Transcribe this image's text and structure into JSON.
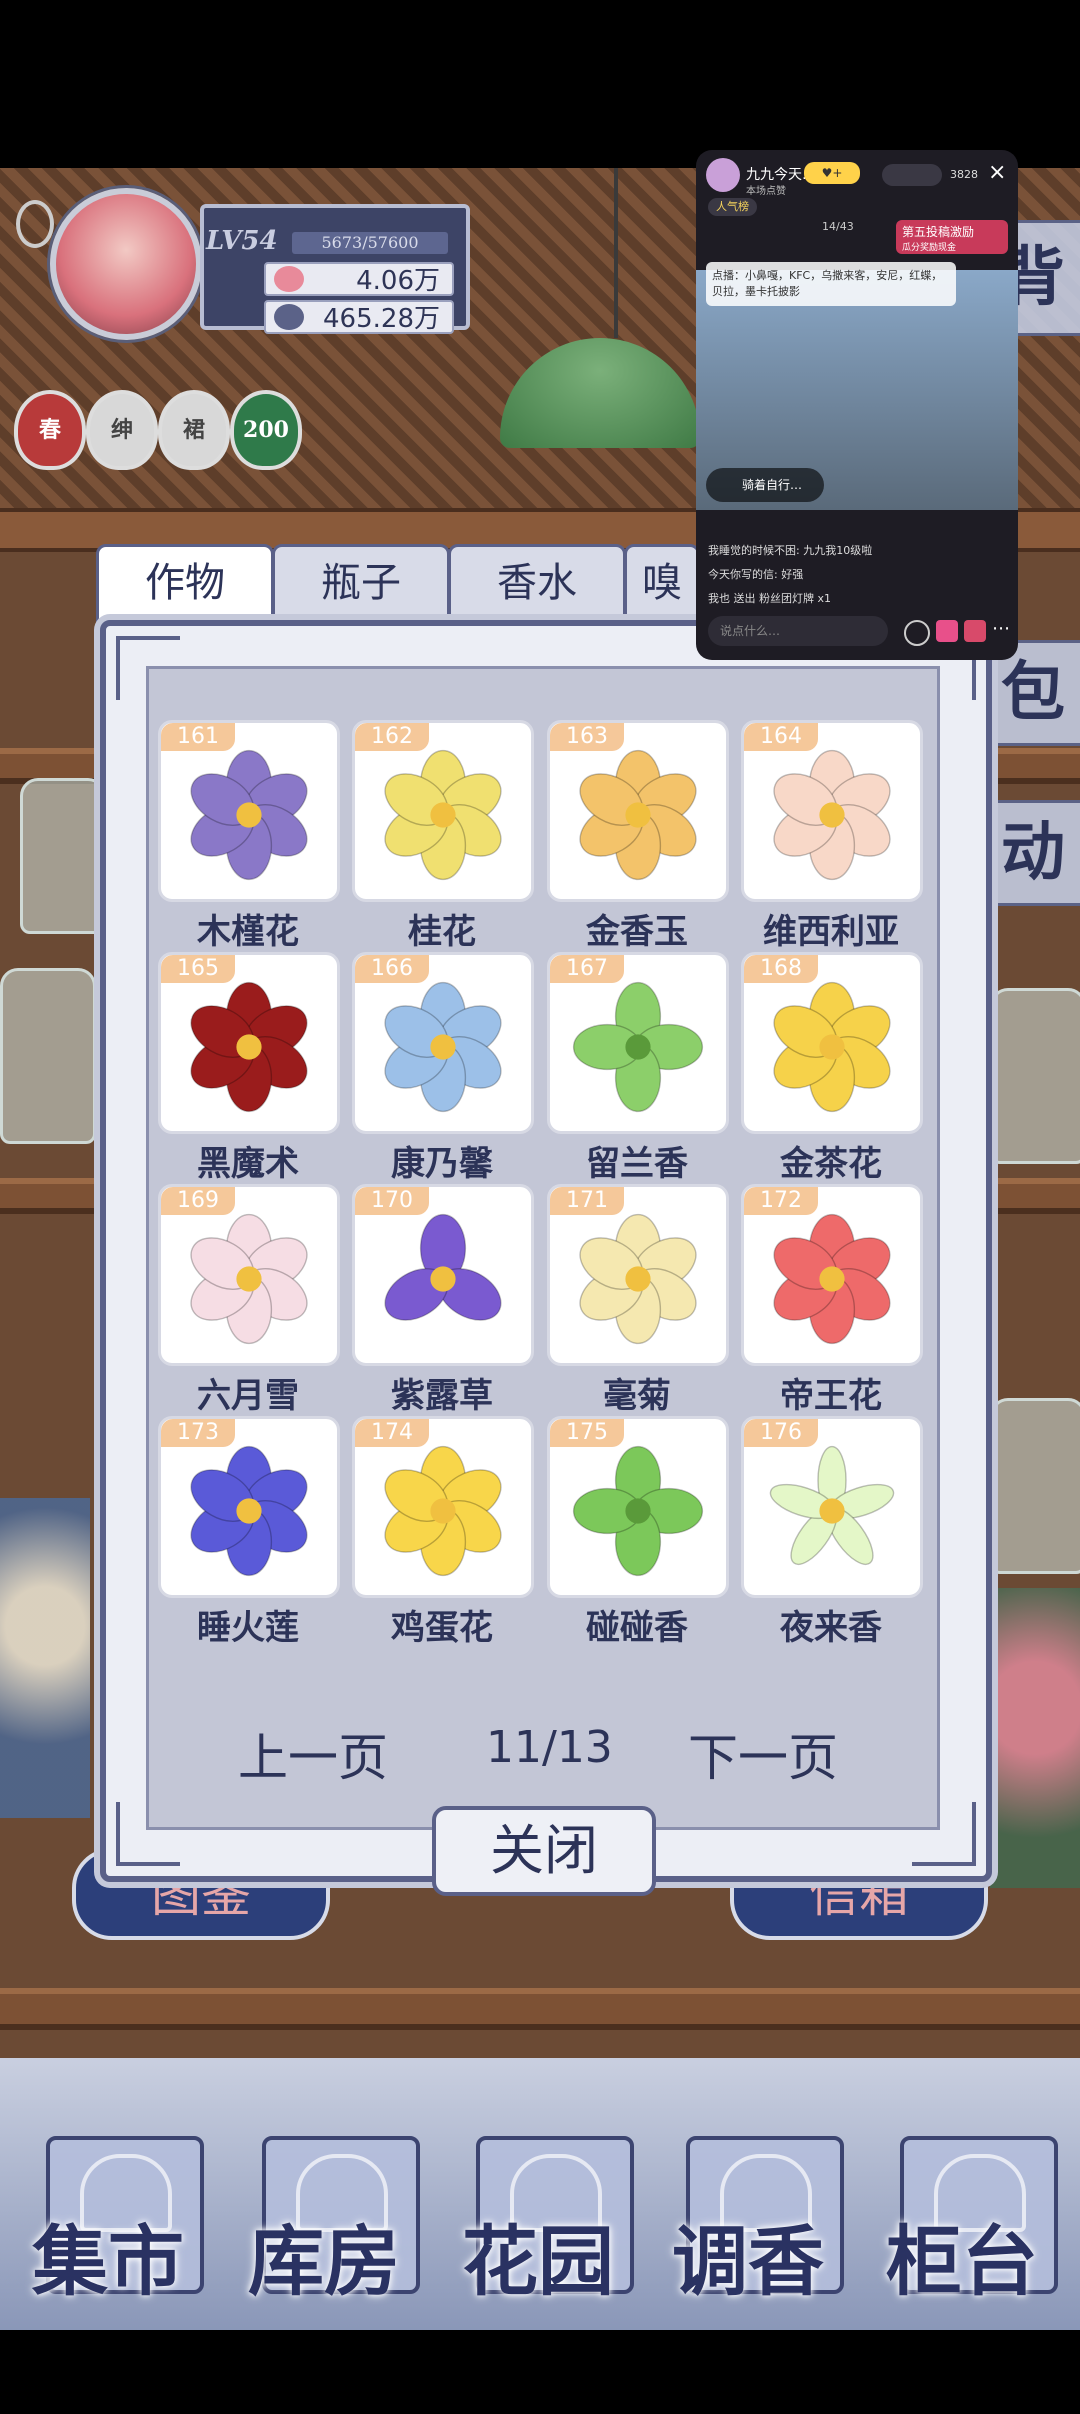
{
  "player": {
    "level": "LV54",
    "xp": "5673/57600",
    "coins": "4.06万",
    "petals": "465.28万",
    "badges": [
      {
        "label": "春",
        "color": "#b83a3a"
      },
      {
        "label": "绅",
        "color": "#d8d8d8"
      },
      {
        "label": "裙",
        "color": "#d8d8d8"
      },
      {
        "label": "200",
        "color": "#2f7a4a"
      }
    ]
  },
  "tabs": [
    {
      "label": "作物",
      "active": true
    },
    {
      "label": "瓶子",
      "active": false
    },
    {
      "label": "香水",
      "active": false
    },
    {
      "label": "嗅",
      "active": false
    }
  ],
  "items": [
    {
      "num": "161",
      "name": "木槿花",
      "color": "#8a78c8",
      "icon": "hibiscus-icon"
    },
    {
      "num": "162",
      "name": "桂花",
      "color": "#f0e070",
      "icon": "osmanthus-icon"
    },
    {
      "num": "163",
      "name": "金香玉",
      "color": "#f3c36a",
      "icon": "rose-icon"
    },
    {
      "num": "164",
      "name": "维西利亚",
      "color": "#f8d8c8",
      "icon": "rose-icon"
    },
    {
      "num": "165",
      "name": "黑魔术",
      "color": "#9a1c1c",
      "icon": "rose-icon"
    },
    {
      "num": "166",
      "name": "康乃馨",
      "color": "#9cc0e8",
      "icon": "carnation-icon"
    },
    {
      "num": "167",
      "name": "留兰香",
      "color": "#8ccf6a",
      "icon": "mint-leaf-icon"
    },
    {
      "num": "168",
      "name": "金茶花",
      "color": "#f6d24a",
      "icon": "camellia-icon"
    },
    {
      "num": "169",
      "name": "六月雪",
      "color": "#f6dde4",
      "icon": "blossom-icon"
    },
    {
      "num": "170",
      "name": "紫露草",
      "color": "#7a5ad0",
      "icon": "spiderwort-icon"
    },
    {
      "num": "171",
      "name": "毫菊",
      "color": "#f5e8b0",
      "icon": "chrysanthemum-icon"
    },
    {
      "num": "172",
      "name": "帝王花",
      "color": "#ee6a6a",
      "icon": "protea-icon"
    },
    {
      "num": "173",
      "name": "睡火莲",
      "color": "#5a5ad8",
      "icon": "waterlily-icon"
    },
    {
      "num": "174",
      "name": "鸡蛋花",
      "color": "#f8d64a",
      "icon": "plumeria-icon"
    },
    {
      "num": "175",
      "name": "碰碰香",
      "color": "#7cc85a",
      "icon": "leaf-cluster-icon"
    },
    {
      "num": "176",
      "name": "夜来香",
      "color": "#e4f7c8",
      "icon": "star-flower-icon"
    }
  ],
  "pager": {
    "prev": "上一页",
    "page": "11/13",
    "next": "下一页"
  },
  "close_label": "关闭",
  "side_menu": [
    "背",
    "包",
    "动"
  ],
  "bottom_nav": [
    {
      "label": "集市",
      "icon": "market-icon"
    },
    {
      "label": "库房",
      "icon": "warehouse-icon"
    },
    {
      "label": "花园",
      "icon": "garden-icon"
    },
    {
      "label": "调香",
      "icon": "perfume-icon"
    },
    {
      "label": "柜台",
      "icon": "counter-icon"
    }
  ],
  "partial_buttons": {
    "left": "图鉴",
    "right": "信箱"
  },
  "stream": {
    "title": "九九今天…",
    "subtitle": "本场点赞",
    "viewers": "3828",
    "popularity": "人气榜",
    "task": "第五投稿激励",
    "task_sub": "瓜分奖励现金",
    "progress": "14/43",
    "pinned": "点播：小鼻嘎，KFC，乌撒来客，安尼，红蝶，贝拉，墨卡托披影",
    "now_playing": "骑着自行…",
    "chat": [
      "我睡觉的时候不困: 九九我10级啦",
      "今天你写的信: 好强",
      "我也 送出 粉丝团灯牌 x1"
    ],
    "input_placeholder": "说点什么…"
  }
}
